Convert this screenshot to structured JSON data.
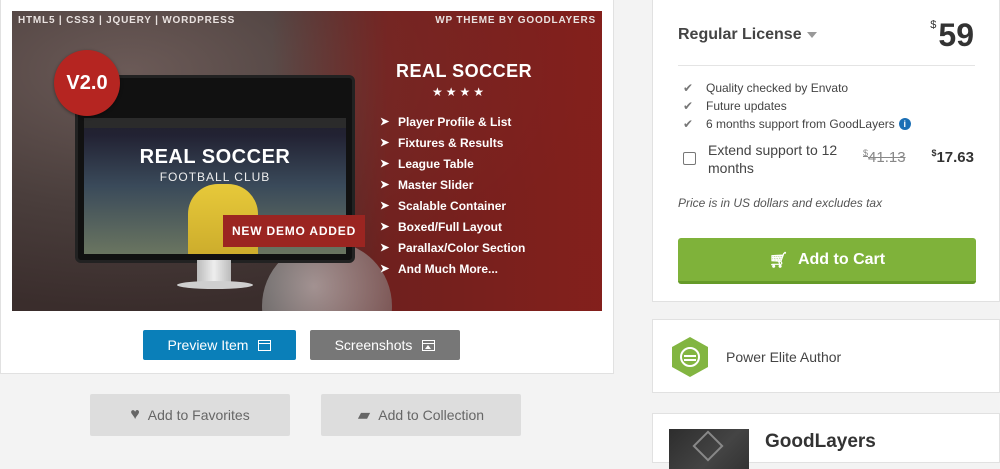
{
  "banner": {
    "tech_line": "HTML5 | CSS3 | JQUERY | WORDPRESS",
    "wp_line": "WP THEME BY GOODLAYERS",
    "version": "V2.0",
    "theme_title": "REAL SOCCER",
    "stars": "★★★★",
    "screen_title": "REAL SOCCER",
    "screen_subtitle": "FOOTBALL CLUB",
    "new_demo_label": "NEW DEMO ADDED",
    "features": [
      "Player Profile & List",
      "Fixtures & Results",
      "League Table",
      "Master Slider",
      "Scalable Container",
      "Boxed/Full Layout",
      "Parallax/Color Section",
      "And Much More..."
    ]
  },
  "actions": {
    "preview_label": "Preview Item",
    "screenshots_label": "Screenshots",
    "favorites_label": "Add to Favorites",
    "collection_label": "Add to Collection"
  },
  "license": {
    "title": "Regular License",
    "currency": "$",
    "price": "59",
    "checks": [
      "Quality checked by Envato",
      "Future updates",
      "6 months support from GoodLayers"
    ],
    "extend_text": "Extend support to 12 months",
    "old_price": "41.13",
    "new_price": "17.63",
    "tax_note": "Price is in US dollars and excludes tax",
    "add_to_cart_label": "Add to Cart",
    "add_to_cart_color": "#7fb23a"
  },
  "author": {
    "badge_label": "Power Elite Author",
    "name": "GoodLayers"
  },
  "colors": {
    "preview_button": "#0a7fb9",
    "banner_red": "#b52521",
    "elite_green": "#82b541"
  }
}
